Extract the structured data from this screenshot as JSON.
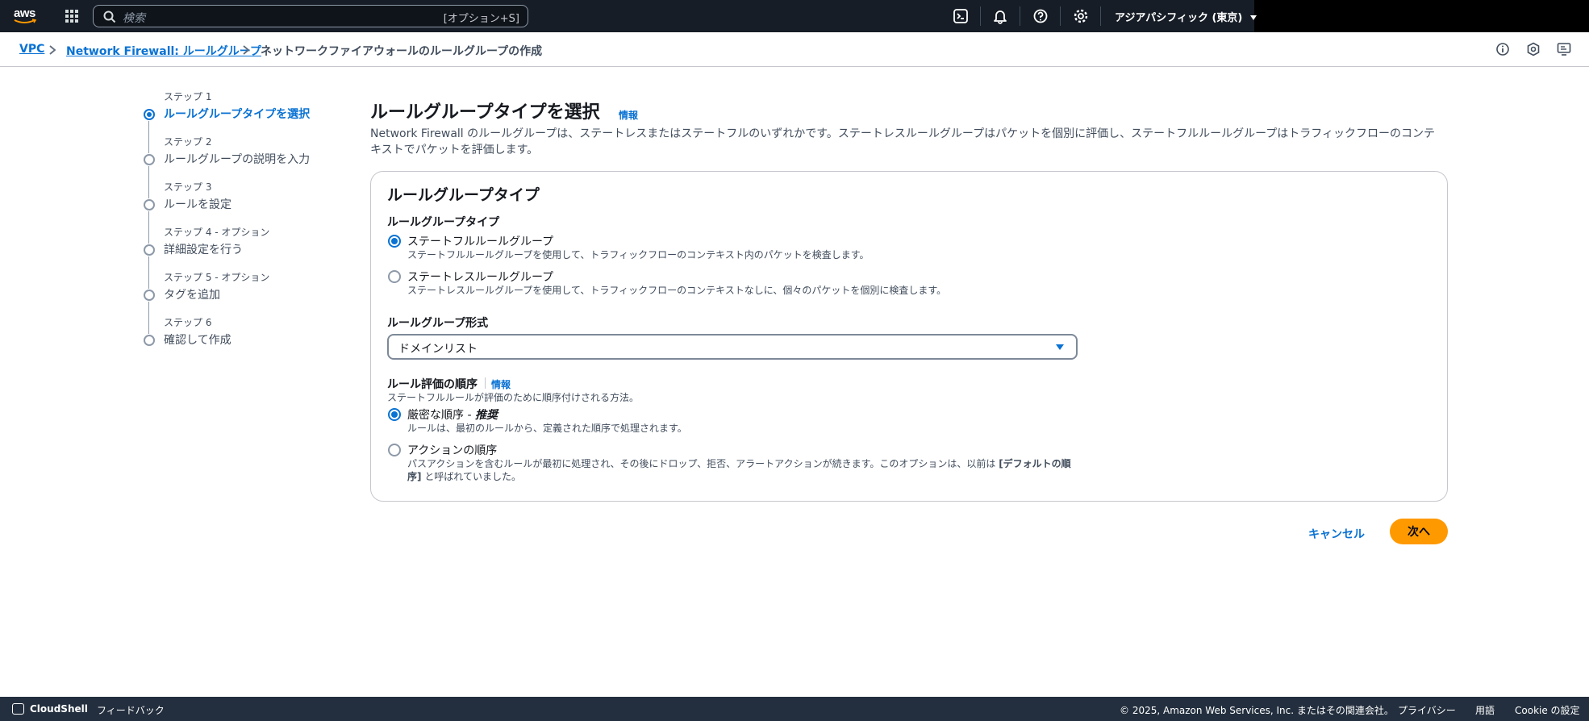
{
  "topnav": {
    "logo_text": "aws",
    "search_placeholder": "検索",
    "search_shortcut": "[オプション+S]",
    "region": "アジアパシフィック (東京)",
    "icons": [
      "apps-grid-icon",
      "search-icon",
      "cloudshell-icon",
      "bell-icon",
      "help-icon",
      "settings-icon",
      "caret-down-icon"
    ]
  },
  "breadcrumb": {
    "items": [
      "VPC",
      "Network Firewall: ルールグループ",
      "ネットワークファイアウォールのルールグループの作成"
    ]
  },
  "wizard": {
    "steps": [
      {
        "num": "ステップ 1",
        "title": "ルールグループタイプを選択",
        "active": true
      },
      {
        "num": "ステップ 2",
        "title": "ルールグループの説明を入力",
        "active": false
      },
      {
        "num": "ステップ 3",
        "title": "ルールを設定",
        "active": false
      },
      {
        "num": "ステップ 4 - オプション",
        "title": "詳細設定を行う",
        "active": false
      },
      {
        "num": "ステップ 5 - オプション",
        "title": "タグを追加",
        "active": false
      },
      {
        "num": "ステップ 6",
        "title": "確認して作成",
        "active": false
      }
    ]
  },
  "main": {
    "title": "ルールグループタイプを選択",
    "info": "情報",
    "description": "Network Firewall のルールグループは、ステートレスまたはステートフルのいずれかです。ステートレスルールグループはパケットを個別に評価し、ステートフルルールグループはトラフィックフローのコンテキストでパケットを評価します。",
    "panel": {
      "heading": "ルールグループタイプ",
      "type_label": "ルールグループタイプ",
      "type_options": [
        {
          "label": "ステートフルルールグループ",
          "desc": "ステートフルルールグループを使用して、トラフィックフローのコンテキスト内のパケットを検査します。",
          "selected": true
        },
        {
          "label": "ステートレスルールグループ",
          "desc": "ステートレスルールグループを使用して、トラフィックフローのコンテキストなしに、個々のパケットを個別に検査します。",
          "selected": false
        }
      ],
      "format_label": "ルールグループ形式",
      "format_value": "ドメインリスト",
      "order_label": "ルール評価の順序",
      "order_info": "情報",
      "order_desc": "ステートフルルールが評価のために順序付けされる方法。",
      "order_options": [
        {
          "label": "厳密な順序 - ",
          "label_em": "推奨",
          "desc": "ルールは、最初のルールから、定義された順序で処理されます。",
          "selected": true
        },
        {
          "label": "アクションの順序",
          "desc_1": "パスアクションを含むルールが最初に処理され、その後にドロップ、拒否、アラートアクションが続きます。このオプションは、以前は ",
          "desc_bold_1": "[デフォルトの順",
          "desc_bold_2": "序]",
          "desc_2": " と呼ばれていました。",
          "selected": false
        }
      ]
    },
    "cancel_label": "キャンセル",
    "next_label": "次へ"
  },
  "footer": {
    "cloudshell": "CloudShell",
    "feedback": "フィードバック",
    "copyright": "© 2025, Amazon Web Services, Inc. またはその関連会社。",
    "privacy": "プライバシー",
    "terms": "用語",
    "cookie": "Cookie の設定"
  }
}
